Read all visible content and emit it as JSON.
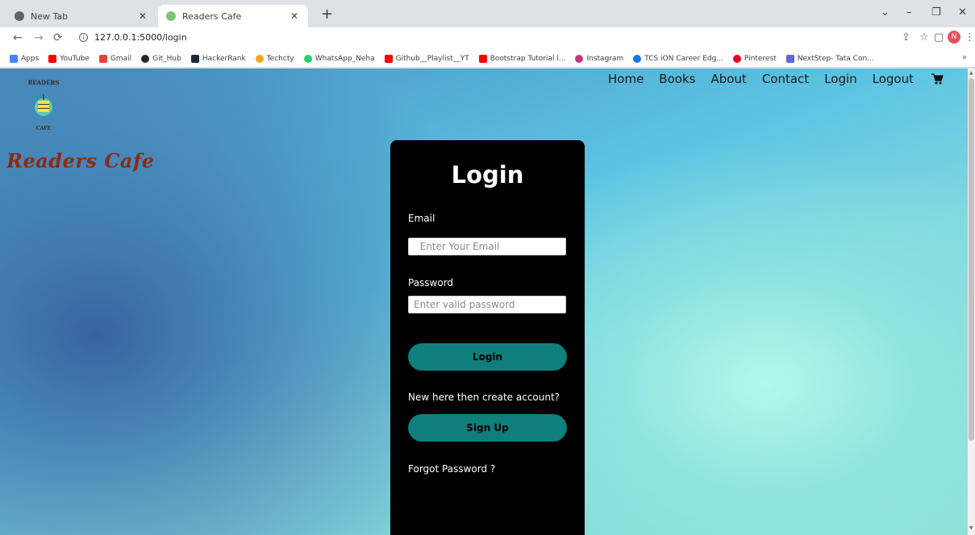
{
  "browser": {
    "tabs": [
      {
        "title": "New Tab",
        "active": false
      },
      {
        "title": "Readers Cafe",
        "active": true
      }
    ],
    "url": "127.0.0.1:5000/login",
    "profile_initial": "N",
    "bookmarks": [
      {
        "label": "Apps",
        "color": "#4285f4"
      },
      {
        "label": "YouTube",
        "color": "#ff0000"
      },
      {
        "label": "Gmail",
        "color": "#ea4335"
      },
      {
        "label": "Git_Hub",
        "color": "#24292e"
      },
      {
        "label": "HackerRank",
        "color": "#1f2937"
      },
      {
        "label": "Techcty",
        "color": "#f5a623"
      },
      {
        "label": "WhatsApp_Neha",
        "color": "#25d366"
      },
      {
        "label": "Github__Playlist__YT",
        "color": "#ff0000"
      },
      {
        "label": "Bootstrap Tutorial l...",
        "color": "#ff0000"
      },
      {
        "label": "Instagram",
        "color": "#c13584"
      },
      {
        "label": "TCS iON Career Edg...",
        "color": "#1a73e8"
      },
      {
        "label": "Pinterest",
        "color": "#e60023"
      },
      {
        "label": "NextStep- Tata Con...",
        "color": "#5b6bd6"
      }
    ]
  },
  "site": {
    "brand": "Readers Cafe",
    "logo": {
      "top_text": "READERS",
      "bottom_text": "CAFE"
    },
    "nav": [
      "Home",
      "Books",
      "About",
      "Contact",
      "Login",
      "Logout"
    ]
  },
  "login": {
    "title": "Login",
    "email_label": "Email",
    "email_placeholder": "  Enter Your Email",
    "password_label": "Password",
    "password_placeholder": "Enter valid password",
    "login_button": "Login",
    "signup_prompt": "New here then create account?",
    "signup_button": "Sign Up",
    "forgot": "Forgot Password ?"
  },
  "colors": {
    "button": "#0e7f7c",
    "card": "#000000",
    "brand": "#8b2a18"
  }
}
